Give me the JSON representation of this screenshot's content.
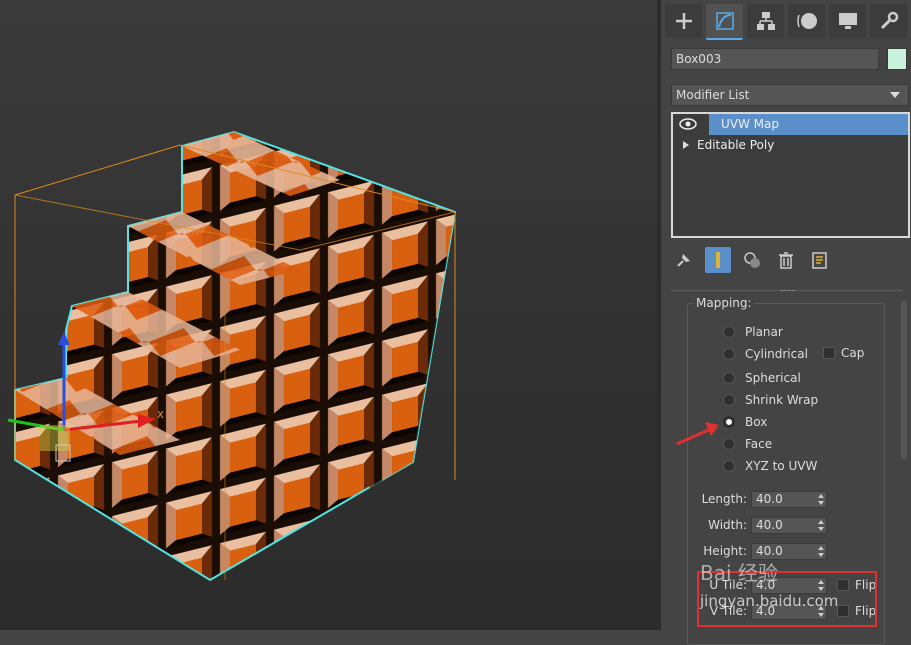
{
  "object_name": "Box003",
  "modifier_list_label": "Modifier List",
  "stack": [
    "UVW Map",
    "Editable Poly"
  ],
  "mapping": {
    "title": "Mapping:",
    "options": [
      "Planar",
      "Cylindrical",
      "Spherical",
      "Shrink Wrap",
      "Box",
      "Face",
      "XYZ to UVW"
    ],
    "selected": "Box",
    "cap_label": "Cap"
  },
  "params": {
    "length_label": "Length:",
    "length_value": "40.0",
    "width_label": "Width:",
    "width_value": "40.0",
    "height_label": "Height:",
    "height_value": "40.0",
    "utile_label": "U Tile:",
    "utile_value": "4.0",
    "vtile_label": "V Tile:",
    "vtile_value": "4.0",
    "flip_label": "Flip"
  },
  "viewport_axis_label": "X",
  "watermark": {
    "line1": "Bai 经验",
    "line2": "jingyan.baidu.com"
  },
  "colors": {
    "accent": "#5b8fc9",
    "selection_outline": "#53e3e3",
    "texture_orange": "#e0661a",
    "highlight_box": "#e03030"
  }
}
